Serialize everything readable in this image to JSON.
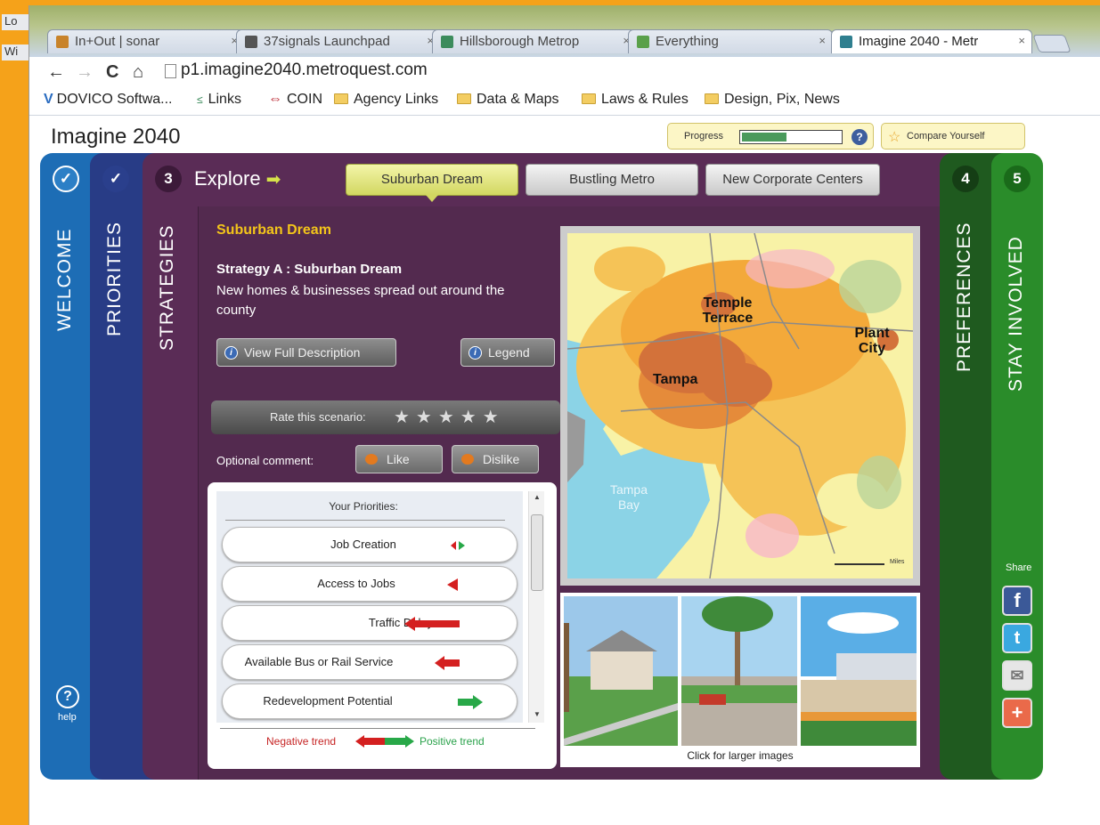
{
  "background_tabs": [
    "Lo",
    "Wi"
  ],
  "tabs": [
    {
      "label": "In+Out | sonar",
      "color": "#c8832a"
    },
    {
      "label": "37signals Launchpad",
      "color": "#555555"
    },
    {
      "label": "Hillsborough Metrop",
      "color": "#3c8c5c"
    },
    {
      "label": "Everything",
      "color": "#5aa04a"
    },
    {
      "label": "Imagine 2040 - Metr",
      "color": "#2f7f8f",
      "active": true
    }
  ],
  "tab_close": "×",
  "nav": {
    "back": "←",
    "forward": "→",
    "reload": "C",
    "home": "⌂"
  },
  "url": "p1.imagine2040.metroquest.com",
  "bookmarks": [
    {
      "label": "DOVICO Softwa...",
      "icon": "v-icon"
    },
    {
      "label": "Links",
      "icon": "links-icon"
    },
    {
      "label": "COIN",
      "icon": "coin-icon"
    },
    {
      "label": "Agency Links",
      "icon": "folder-icon"
    },
    {
      "label": "Data & Maps",
      "icon": "folder-icon"
    },
    {
      "label": "Laws & Rules",
      "icon": "folder-icon"
    },
    {
      "label": "Design, Pix, News",
      "icon": "folder-icon"
    }
  ],
  "app": {
    "title": "Imagine 2040",
    "progress_label": "Progress",
    "progress_value": 0.45,
    "help_symbol": "?",
    "compare_label": "Compare Yourself"
  },
  "steps": {
    "welcome": {
      "label": "WELCOME",
      "mark": "✓"
    },
    "priorities": {
      "label": "PRIORITIES",
      "mark": "✓"
    },
    "strategies": {
      "label": "STRATEGIES",
      "number": "3"
    },
    "preferences": {
      "label": "PREFERENCES",
      "number": "4"
    },
    "stay": {
      "label": "STAY INVOLVED",
      "number": "5"
    }
  },
  "help": {
    "symbol": "?",
    "label": "help"
  },
  "explore": {
    "label": "Explore",
    "arrow": "➡"
  },
  "scenarios": [
    "Suburban Dream",
    "Bustling Metro",
    "New Corporate Centers"
  ],
  "detail": {
    "heading": "Suburban Dream",
    "strategy_title": "Strategy A : Suburban Dream",
    "description": "New homes & businesses spread out around the county",
    "view_full": "View Full Description",
    "legend": "Legend",
    "info_symbol": "i",
    "rate_label": "Rate this scenario:",
    "stars": "★★★★★",
    "optional_comment": "Optional comment:",
    "like": "Like",
    "dislike": "Dislike"
  },
  "priorities": {
    "title": "Your Priorities:",
    "items": [
      {
        "label": "Job Creation",
        "trend": "mixed"
      },
      {
        "label": "Access to Jobs",
        "trend": "negative-small"
      },
      {
        "label": "Traffic Delay",
        "trend": "negative-large"
      },
      {
        "label": "Available Bus or Rail Service",
        "trend": "negative-medium"
      },
      {
        "label": "Redevelopment Potential",
        "trend": "positive-medium"
      }
    ],
    "negative_label": "Negative trend",
    "positive_label": "Positive trend",
    "scroll_up": "▲",
    "scroll_down": "▼"
  },
  "map": {
    "labels": [
      "Temple Terrace",
      "Plant City",
      "Tampa",
      "Tampa Bay"
    ],
    "scale": "Miles"
  },
  "photos_caption": "Click for larger images",
  "share": {
    "label": "Share",
    "facebook": "f",
    "twitter": "t",
    "email": "✉",
    "more": "+"
  },
  "colors": {
    "welcome": "#1d6db5",
    "priorities": "#283c86",
    "strategies": "#5a2c56",
    "preferences": "#1f5a1f",
    "stay": "#2a8c2a",
    "accent_yellow": "#f3c51a",
    "negative": "#d42020",
    "positive": "#28a848"
  }
}
